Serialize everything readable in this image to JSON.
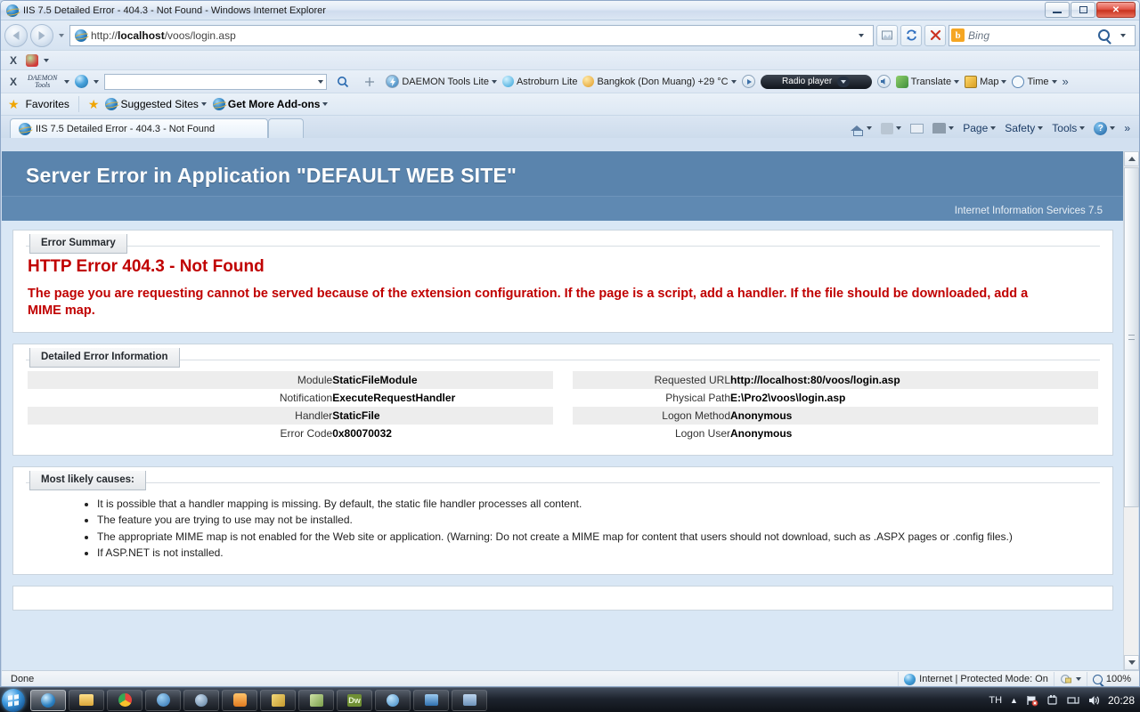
{
  "window": {
    "title": "IIS 7.5 Detailed Error - 404.3 - Not Found - Windows Internet Explorer",
    "minimize_label": "Minimize",
    "maximize_label": "Restore",
    "close_label": "✕"
  },
  "address_bar": {
    "back_label": "Back",
    "forward_label": "Forward",
    "url_prefix": "http://",
    "url_host": "localhost",
    "url_path": "/voos/login.asp",
    "full_url": "http://localhost/voos/login.asp",
    "search_engine": "Bing",
    "search_engine_initial": "b",
    "refresh_label": "Refresh",
    "stop_label": "Stop",
    "compat_label": "Compatibility View"
  },
  "toolbars": {
    "row1_close": "X",
    "row2_close": "X",
    "daemon_brand_line1": "DAEMON",
    "daemon_brand_line2": "Tools",
    "items": [
      {
        "label": "DAEMON Tools Lite",
        "icon": "daemon-lightning-icon",
        "has_caret": true
      },
      {
        "label": "Astroburn Lite",
        "icon": "astroburn-icon",
        "has_caret": false
      },
      {
        "label": "Bangkok (Don Muang) +29 °C",
        "icon": "weather-icon",
        "has_caret": true
      }
    ],
    "radio_player": "Radio player",
    "right_items": [
      {
        "label": "Translate",
        "icon": "translate-icon",
        "has_caret": true
      },
      {
        "label": "Map",
        "icon": "map-icon",
        "has_caret": true
      },
      {
        "label": "Time",
        "icon": "clock-icon",
        "has_caret": true
      }
    ],
    "overflow": "»"
  },
  "favorites_bar": {
    "favorites_label": "Favorites",
    "items": [
      {
        "label": "Suggested Sites",
        "icon": "ie-icon",
        "has_caret": true
      },
      {
        "label": "Get More Add-ons",
        "icon": "ie-icon",
        "has_caret": true
      }
    ]
  },
  "tabs": {
    "open": [
      {
        "label": "IIS 7.5 Detailed Error - 404.3 - Not Found",
        "icon": "ie-icon",
        "active": true
      }
    ],
    "new_tab_label": ""
  },
  "command_bar": {
    "items": [
      {
        "label": "",
        "icon": "home-icon",
        "has_caret": true
      },
      {
        "label": "",
        "icon": "feeds-icon",
        "has_caret": true
      },
      {
        "label": "",
        "icon": "mail-icon",
        "has_caret": false
      },
      {
        "label": "",
        "icon": "print-icon",
        "has_caret": true
      },
      {
        "label": "Page",
        "icon": "",
        "has_caret": true
      },
      {
        "label": "Safety",
        "icon": "",
        "has_caret": true
      },
      {
        "label": "Tools",
        "icon": "",
        "has_caret": true
      },
      {
        "label": "",
        "icon": "help-icon",
        "has_caret": true
      }
    ],
    "overflow": "»"
  },
  "page": {
    "header_title": "Server Error in Application \"DEFAULT WEB SITE\"",
    "header_subtitle": "Internet Information Services 7.5",
    "header_bg": "#5a84ad",
    "error_color": "#c00000",
    "error_summary": {
      "panel_label": "Error Summary",
      "title": "HTTP Error 404.3 - Not Found",
      "description": "The page you are requesting cannot be served because of the extension configuration. If the page is a script, add a handler. If the file should be downloaded, add a MIME map."
    },
    "detailed_error": {
      "panel_label": "Detailed Error Information",
      "left_rows": [
        {
          "label": "Module",
          "value": "StaticFileModule"
        },
        {
          "label": "Notification",
          "value": "ExecuteRequestHandler"
        },
        {
          "label": "Handler",
          "value": "StaticFile"
        },
        {
          "label": "Error Code",
          "value": "0x80070032"
        }
      ],
      "right_rows": [
        {
          "label": "Requested URL",
          "value": "http://localhost:80/voos/login.asp"
        },
        {
          "label": "Physical Path",
          "value": "E:\\Pro2\\voos\\login.asp"
        },
        {
          "label": "Logon Method",
          "value": "Anonymous"
        },
        {
          "label": "Logon User",
          "value": "Anonymous"
        }
      ]
    },
    "most_likely_causes": {
      "panel_label": "Most likely causes:",
      "items": [
        "It is possible that a handler mapping is missing. By default, the static file handler processes all content.",
        "The feature you are trying to use may not be installed.",
        "The appropriate MIME map is not enabled for the Web site or application. (Warning: Do not create a MIME map for content that users should not download, such as .ASPX pages or .config files.)",
        "If ASP.NET is not installed."
      ]
    }
  },
  "status_bar": {
    "status_text": "Done",
    "zone_text": "Internet | Protected Mode: On",
    "zoom_level": "100%"
  },
  "taskbar": {
    "start_label": "Start",
    "buttons": [
      {
        "name": "internet-explorer",
        "color": "#7fc4ee",
        "active": true
      },
      {
        "name": "windows-explorer",
        "color": "#e8c066",
        "active": false
      },
      {
        "name": "google-chrome",
        "color": "#3aa757",
        "active": false
      },
      {
        "name": "maxthon-browser",
        "color": "#3f84c9",
        "active": false
      },
      {
        "name": "opera-browser",
        "color": "#6b87a8",
        "active": false
      },
      {
        "name": "media-player",
        "color": "#f08a30",
        "active": false
      },
      {
        "name": "photo-app",
        "color": "#d9b64c",
        "active": false
      },
      {
        "name": "team-app",
        "color": "#9ac26d",
        "active": false
      },
      {
        "name": "dreamweaver",
        "color": "#6f8f34",
        "active": false,
        "text": "Dw"
      },
      {
        "name": "blue-globe-app",
        "color": "#4e9ad0",
        "active": false
      },
      {
        "name": "outlook-app",
        "color": "#4d85c5",
        "active": false
      },
      {
        "name": "media-center",
        "color": "#7da0c6",
        "active": false
      }
    ],
    "language": "TH",
    "clock": "20:28"
  }
}
